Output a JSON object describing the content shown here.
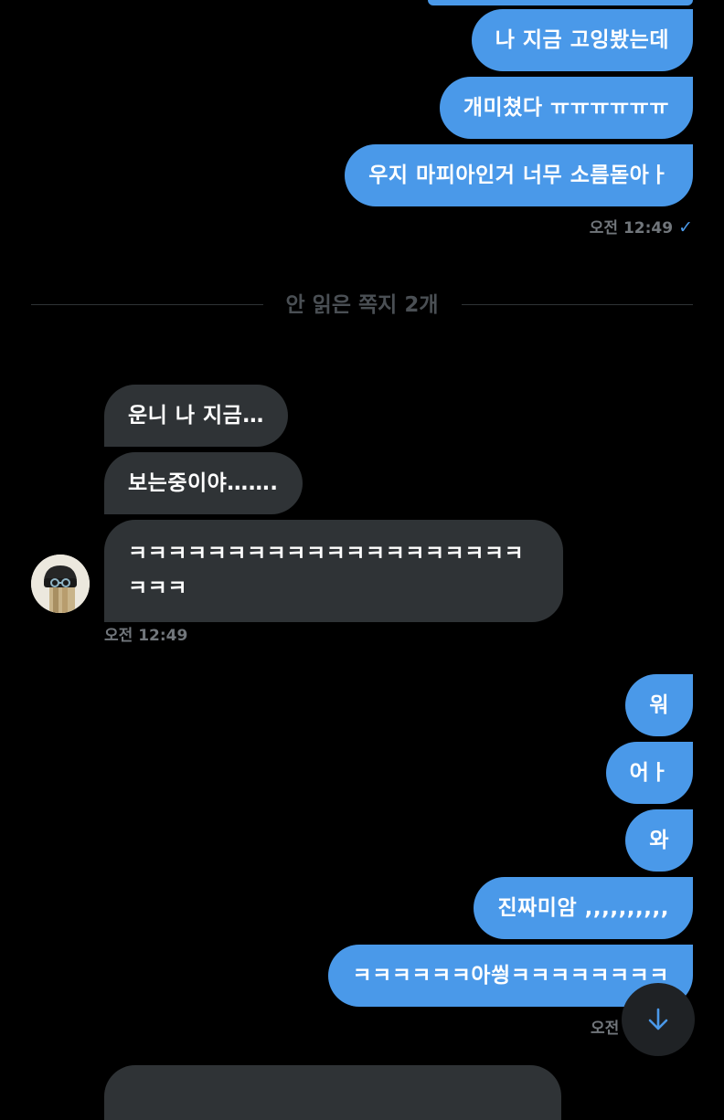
{
  "colors": {
    "background": "#000000",
    "sent_bubble": "#4a99e9",
    "received_bubble": "#2f3336",
    "timestamp": "#71767b",
    "divider_text": "#4a4f54",
    "scroll_button": "#1f2225"
  },
  "messages_sent_1": {
    "items": [
      {
        "text": "나 지금 고잉봤는데"
      },
      {
        "text": "개미쳤다 ㅠㅠㅠㅠㅠㅠ"
      },
      {
        "text": "우지 마피아인거 너무 소름돋아ㅏ"
      }
    ],
    "timestamp": "오전 12:49",
    "status_icon": "check-icon",
    "status_glyph": "✓"
  },
  "unread_divider": {
    "label": "안 읽은 쪽지 2개"
  },
  "messages_received": {
    "items": [
      {
        "text": "운니 나 지금…"
      },
      {
        "text": "보는중이야……."
      },
      {
        "text": "ㅋㅋㅋㅋㅋㅋㅋㅋㅋㅋㅋㅋㅋㅋㅋㅋㅋㅋㅋㅋㅋㅋㅋ"
      }
    ],
    "timestamp": "오전 12:49",
    "avatar_icon": "avatar-icon"
  },
  "messages_sent_2": {
    "items": [
      {
        "text": "워"
      },
      {
        "text": "어ㅏ"
      },
      {
        "text": "와"
      },
      {
        "text": "진짜미암 ,,,,,,,,,,"
      },
      {
        "text": "ㅋㅋㅋㅋㅋㅋ아씡ㅋㅋㅋㅋㅋㅋㅋㅋ"
      }
    ],
    "timestamp": "오전"
  },
  "scroll_down_button": {
    "icon": "arrow-down-icon"
  }
}
